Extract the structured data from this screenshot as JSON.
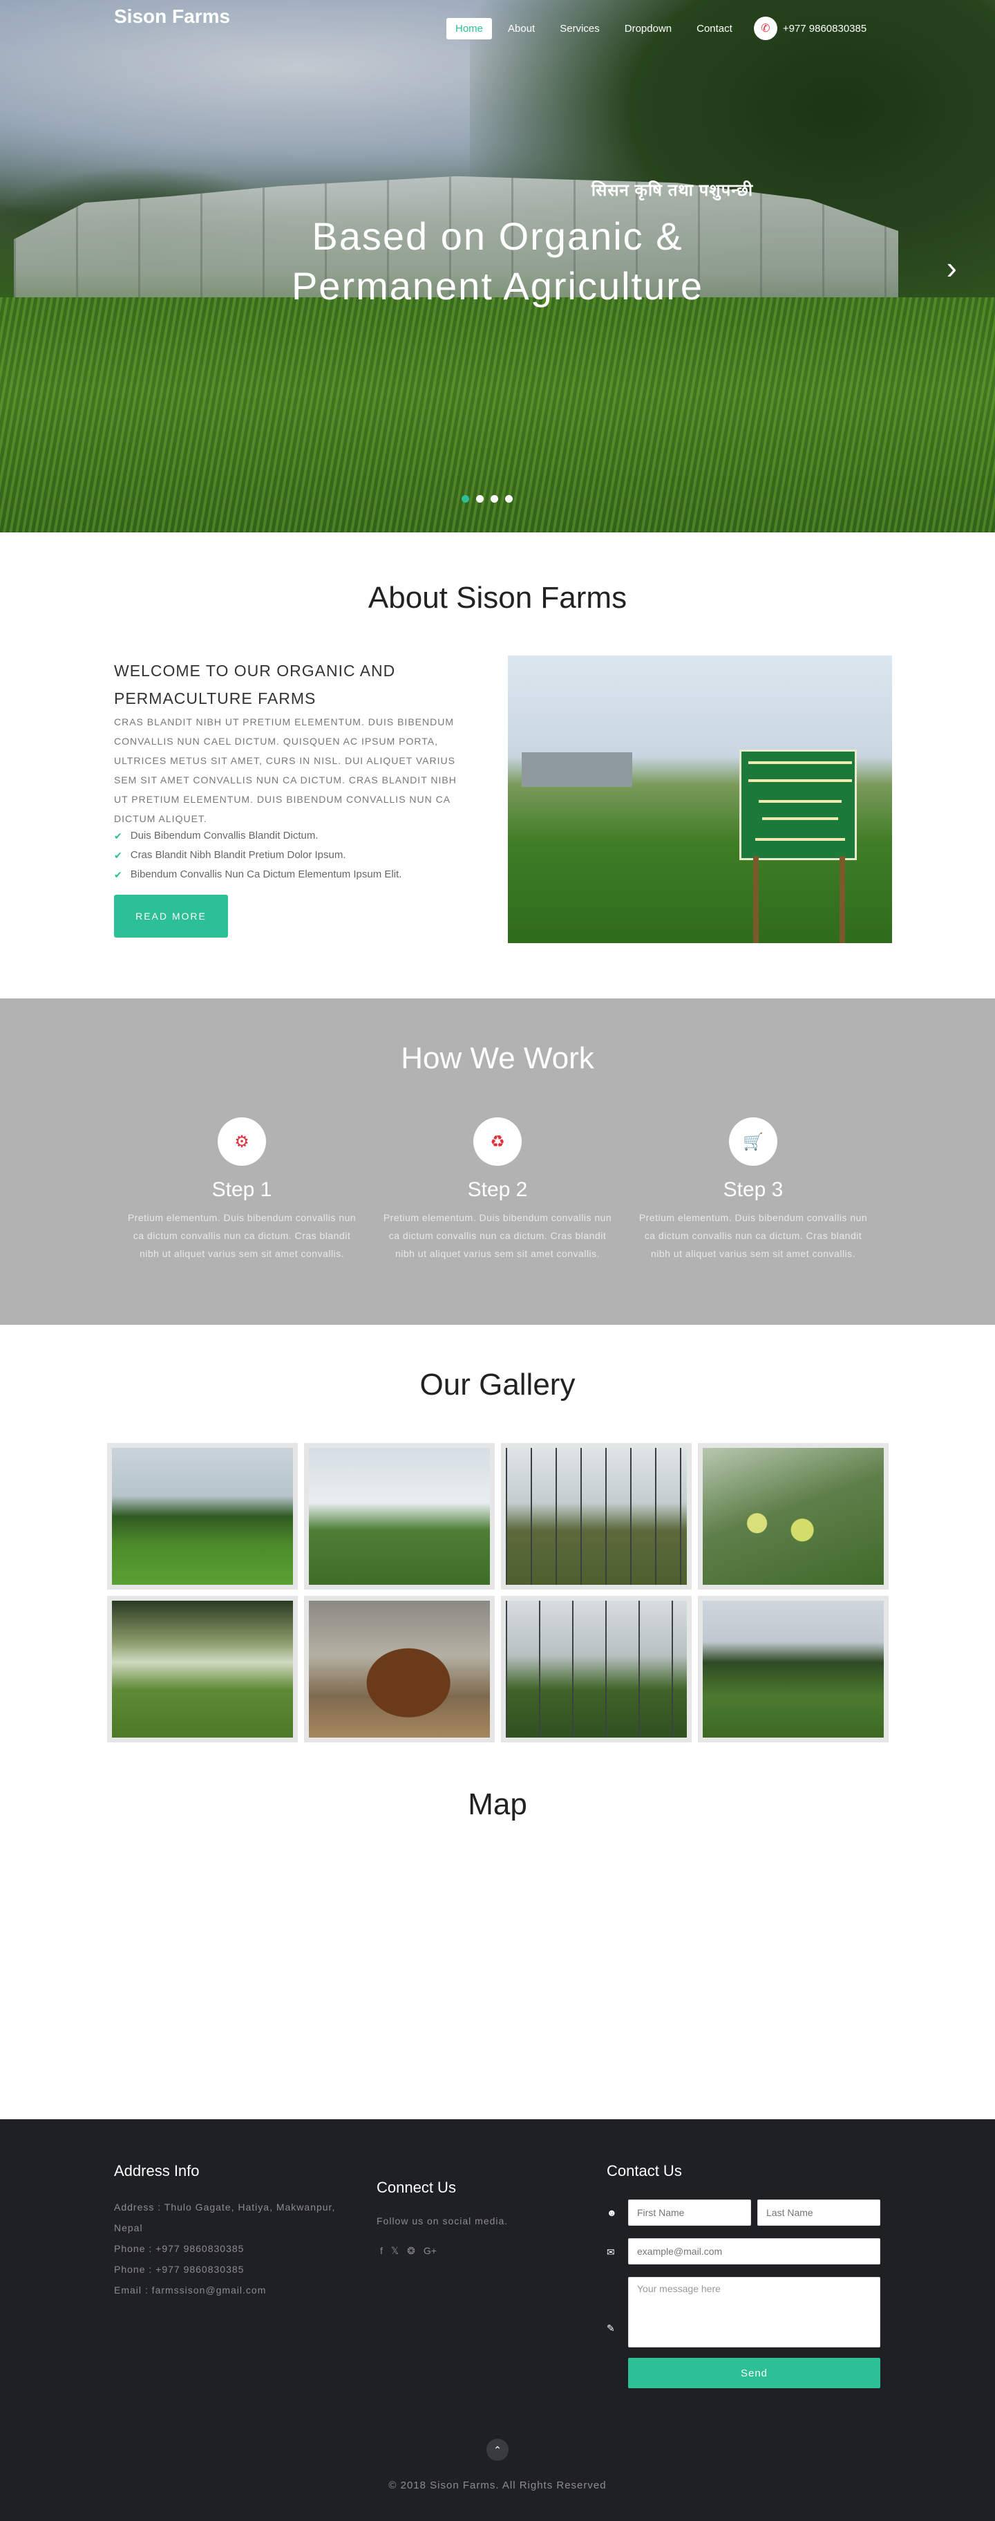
{
  "brand": "Sison Farms",
  "nav": {
    "items": [
      "Home",
      "About",
      "Services",
      "Dropdown",
      "Contact"
    ],
    "active": "Home",
    "phone": "+977 9860830385"
  },
  "hero": {
    "small_text": "सिसन कृषि तथा पशुपन्छी",
    "title_line1": "Based on Organic &",
    "title_line2": "Permanent Agriculture",
    "slide_count": 4,
    "active_slide": 1
  },
  "about": {
    "title": "About Sison Farms",
    "heading": "WELCOME TO OUR ORGANIC AND PERMACULTURE FARMS",
    "paragraph": "CRAS BLANDIT NIBH UT PRETIUM ELEMENTUM. DUIS BIBENDUM CONVALLIS NUN CAEL DICTUM. QUISQUEN AC IPSUM PORTA, ULTRICES METUS SIT AMET, CURS IN NISL. DUI ALIQUET VARIUS SEM SIT AMET CONVALLIS NUN CA DICTUM. CRAS BLANDIT NIBH UT PRETIUM ELEMENTUM. DUIS BIBENDUM CONVALLIS NUN CA DICTUM ALIQUET.",
    "list": [
      "Duis Bibendum Convallis Blandit Dictum.",
      "Cras Blandit Nibh Blandit Pretium Dolor Ipsum.",
      "Bibendum Convallis Nun Ca Dictum Elementum Ipsum Elit."
    ],
    "button": "READ MORE"
  },
  "how": {
    "title": "How We Work",
    "steps": [
      {
        "title": "Step 1",
        "text": "Pretium elementum. Duis bibendum convallis nun ca dictum convallis nun ca dictum. Cras blandit nibh ut aliquet varius sem sit amet convallis.",
        "icon": "gears-icon"
      },
      {
        "title": "Step 2",
        "text": "Pretium elementum. Duis bibendum convallis nun ca dictum convallis nun ca dictum. Cras blandit nibh ut aliquet varius sem sit amet convallis.",
        "icon": "recycle-icon"
      },
      {
        "title": "Step 3",
        "text": "Pretium elementum. Duis bibendum convallis nun ca dictum convallis nun ca dictum. Cras blandit nibh ut aliquet varius sem sit amet convallis.",
        "icon": "cart-icon"
      }
    ]
  },
  "gallery": {
    "title": "Our Gallery",
    "count": 8
  },
  "map": {
    "title": "Map"
  },
  "footer": {
    "address_title": "Address Info",
    "address_lines": [
      "Address : Thulo Gagate, Hatiya, Makwanpur, Nepal",
      "Phone : +977 9860830385",
      "Phone : +977 9860830385",
      "Email : farmssison@gmail.com"
    ],
    "connect_title": "Connect Us",
    "connect_text": "Follow us on social media.",
    "contact_title": "Contact Us",
    "first_name_placeholder": "First Name",
    "last_name_placeholder": "Last Name",
    "email_placeholder": "example@mail.com",
    "message_placeholder": "Your message here",
    "send": "Send",
    "copyright": "© 2018 Sison Farms. All Rights Reserved"
  },
  "colors": {
    "accent": "#2dbf96",
    "icon_red": "#e0303c",
    "footer_bg": "#1f2024",
    "how_bg": "#b2b2b2"
  }
}
